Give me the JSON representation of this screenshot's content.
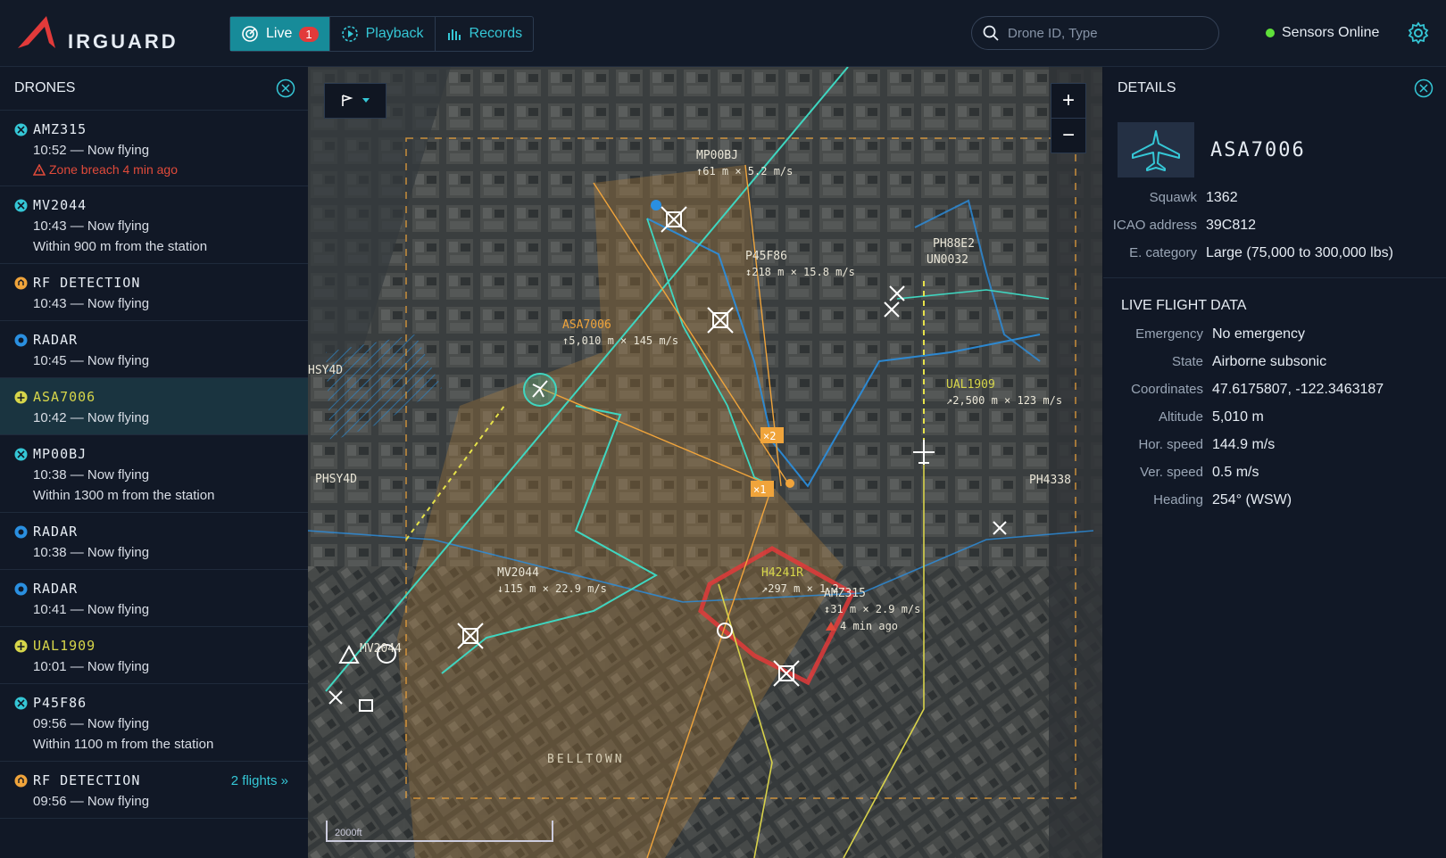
{
  "header": {
    "logo_text": "IRGUARD",
    "tabs": [
      {
        "label": "Live",
        "badge": "1"
      },
      {
        "label": "Playback"
      },
      {
        "label": "Records"
      }
    ],
    "search_placeholder": "Drone ID, Type",
    "sensors_status": "Sensors Online"
  },
  "sidebar": {
    "title": "DRONES",
    "items": [
      {
        "name": "AMZ315",
        "time": "10:52 — Now flying",
        "warning": "Zone breach 4 min ago",
        "icon": "drone-icon"
      },
      {
        "name": "MV2044",
        "time": "10:43 — Now flying",
        "extra": "Within 900 m from the station",
        "icon": "drone-icon"
      },
      {
        "name": "RF DETECTION",
        "time": "10:43 — Now flying",
        "icon": "rf-icon"
      },
      {
        "name": "RADAR",
        "time": "10:45 — Now flying",
        "icon": "radar-icon"
      },
      {
        "name": "ASA7006",
        "time": "10:42 — Now flying",
        "icon": "aircraft-icon",
        "selected": true
      },
      {
        "name": "MP00BJ",
        "time": "10:38 — Now flying",
        "extra": "Within 1300 m from the station",
        "icon": "drone-icon"
      },
      {
        "name": "RADAR",
        "time": "10:38 — Now flying",
        "icon": "radar-icon"
      },
      {
        "name": "RADAR",
        "time": "10:41 — Now flying",
        "icon": "radar-icon"
      },
      {
        "name": "UAL1909",
        "time": "10:01 — Now flying",
        "icon": "aircraft-icon"
      },
      {
        "name": "P45F86",
        "time": "09:56 — Now flying",
        "extra": "Within 1100 m from the station",
        "icon": "drone-icon"
      },
      {
        "name": "RF DETECTION",
        "time": "09:56 — Now flying",
        "icon": "rf-icon",
        "link": "2 flights »"
      }
    ]
  },
  "map": {
    "zoom_in": "+",
    "zoom_out": "−",
    "scale_label": "2000ft",
    "labels": {
      "mp00bj": "MP00BJ",
      "mp00bj_sub": "↑61 m × 5.2 m/s",
      "p45f86": "P45F86",
      "p45f86_sub": "↕218 m × 15.8 m/s",
      "asa7006": "ASA7006",
      "asa7006_sub": "↑5,010 m × 145 m/s",
      "ph88e2": "PH88E2",
      "un0032": "UN0032",
      "ual1909": "UAL1909",
      "ual1909_sub": "↗2,500 m × 123 m/s",
      "ph4338": "PH4338",
      "phsy4d_a": "HSY4D",
      "phsy4d_b": "PHSY4D",
      "mv2044": "MV2044",
      "mv2044_sub": "↓115 m × 22.9 m/s",
      "mv2044_b": "MV2044",
      "h4241r": "H4241R",
      "h4241r_sub": "↗297 m × 1.2",
      "amz315": "AMZ315",
      "amz315_sub": "↕31 m × 2.9 m/s",
      "amz315_warn": "4 min ago",
      "x2": "×2",
      "x1": "×1",
      "belltown": "BELLTOWN"
    }
  },
  "details": {
    "title": "DETAILS",
    "aircraft_id": "ASA7006",
    "fields": [
      {
        "k": "Squawk",
        "v": "1362"
      },
      {
        "k": "ICAO address",
        "v": "39C812"
      },
      {
        "k": "E. category",
        "v": "Large (75,000 to 300,000 lbs)"
      }
    ],
    "live_title": "LIVE FLIGHT DATA",
    "live": [
      {
        "k": "Emergency",
        "v": "No emergency"
      },
      {
        "k": "State",
        "v": "Airborne  subsonic"
      },
      {
        "k": "Coordinates",
        "v": "47.6175807, -122.3463187"
      },
      {
        "k": "Altitude",
        "v": "5,010 m"
      },
      {
        "k": "Hor. speed",
        "v": "144.9 m/s"
      },
      {
        "k": "Ver. speed",
        "v": "0.5 m/s"
      },
      {
        "k": "Heading",
        "v": "254° (WSW)"
      }
    ]
  },
  "colors": {
    "accent": "#35c7d6",
    "warning": "#e04a3a",
    "amber": "#f0a43b",
    "online": "#5fe03a"
  }
}
